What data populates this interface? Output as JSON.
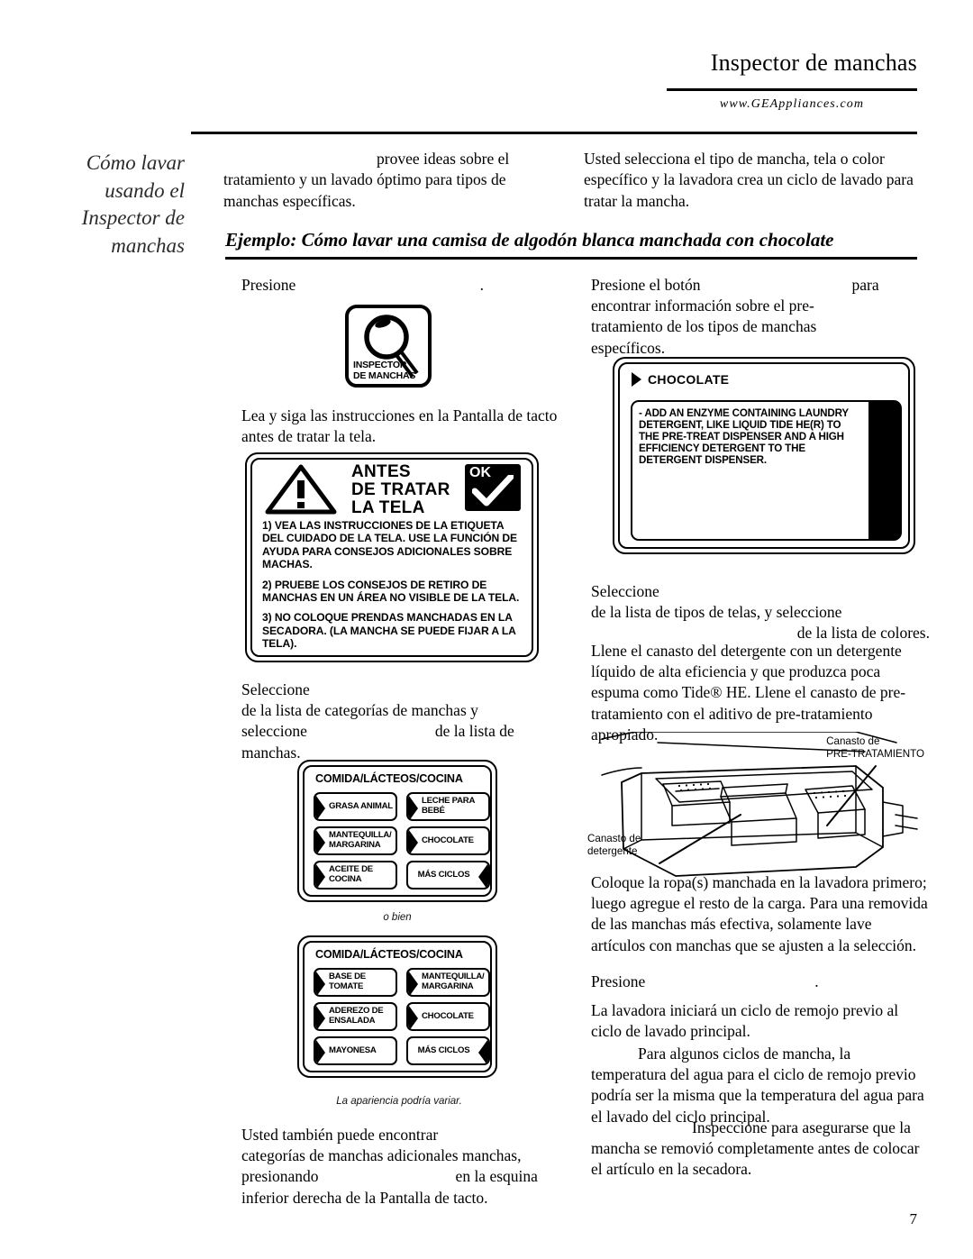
{
  "header": {
    "title": "Inspector de manchas",
    "url": "www.GEAppliances.com"
  },
  "side_title": "Cómo lavar usando el Inspector de manchas",
  "intro": {
    "left": "provee ideas sobre el tratamiento y un lavado óptimo para tipos de manchas específicas.",
    "right": "Usted selecciona el tipo de mancha, tela o color específico y la lavadora crea un ciclo de lavado para tratar la mancha."
  },
  "example_heading": "Ejemplo: Cómo lavar una camisa de algodón blanca manchada con chocolate",
  "left_column": {
    "step1": "Presione",
    "step1_tail": ".",
    "inspector_button": {
      "line1": "INSPECTOR",
      "line2": "DE MANCHAS"
    },
    "step2": "Lea y siga las instrucciones en la Pantalla de tacto antes de tratar la tela.",
    "antes_box": {
      "title_line1": "ANTES",
      "title_line2": "DE TRATAR",
      "title_line3": "LA TELA",
      "ok_label": "OK",
      "items": [
        "1) VEA LAS INSTRUCCIONES DE LA ETIQUETA DEL CUIDADO DE LA TELA. USE LA FUNCIÓN DE AYUDA PARA CONSEJOS ADICIONALES SOBRE MACHAS.",
        "2) PRUEBE LOS CONSEJOS DE RETIRO DE MANCHAS EN UN ÁREA NO VISIBLE DE LA TELA.",
        "3) NO COLOQUE PRENDAS MANCHADAS EN LA SECADORA. (LA MANCHA SE PUEDE FIJAR A LA TELA)."
      ]
    },
    "step3_a": "Seleccione",
    "step3_b": "de la lista de categorías de manchas y",
    "step3_c": "seleccione",
    "step3_d": "de la lista de",
    "step3_e": "manchas.",
    "menu1": {
      "title": "COMIDA/LÁCTEOS/COCINA",
      "buttons": [
        {
          "label": "GRASA ANIMAL",
          "arrow": "left"
        },
        {
          "label": "LECHE PARA BEBÉ",
          "arrow": "left"
        },
        {
          "label": "MANTEQUILLA/ MARGARINA",
          "arrow": "left"
        },
        {
          "label": "CHOCOLATE",
          "arrow": "left"
        },
        {
          "label": "ACEITE DE COCINA",
          "arrow": "left"
        },
        {
          "label": "MÁS CICLOS",
          "arrow": "right"
        }
      ]
    },
    "or_caption": "o bien",
    "menu2": {
      "title": "COMIDA/LÁCTEOS/COCINA",
      "buttons": [
        {
          "label": "BASE DE TOMATE",
          "arrow": "left"
        },
        {
          "label": "MANTEQUILLA/ MARGARINA",
          "arrow": "left"
        },
        {
          "label": "ADEREZO DE ENSALADA",
          "arrow": "left"
        },
        {
          "label": "CHOCOLATE",
          "arrow": "left"
        },
        {
          "label": "MAYONESA",
          "arrow": "left"
        },
        {
          "label": "MÁS CICLOS",
          "arrow": "right"
        }
      ]
    },
    "variation_caption": "La apariencia podría variar.",
    "step4_a": "Usted también puede encontrar",
    "step4_b": "categorías de manchas adicionales manchas,",
    "step4_c": "presionando",
    "step4_d": "en la esquina",
    "step4_e": "inferior derecha de la Pantalla de tacto."
  },
  "right_column": {
    "step1_a": "Presione el botón",
    "step1_b": "para",
    "step1_c": "encontrar información sobre el pre-",
    "step1_d": "tratamiento de los tipos de manchas",
    "step1_e": "específicos.",
    "chocolate_panel": {
      "heading": "CHOCOLATE",
      "body": "- ADD AN ENZYME CONTAINING LAUNDRY DETERGENT, LIKE LIQUID TIDE HE(R) TO THE PRE-TREAT DISPENSER AND A HIGH EFFICIENCY DETERGENT TO THE DETERGENT DISPENSER."
    },
    "step2_a": "Seleccione",
    "step2_b": "de la lista de tipos de telas, y seleccione",
    "step2_c": "de la lista de colores.",
    "step3": "Llene el canasto del detergente con un detergente líquido de alta eficiencia y que produzca poca espuma como Tide® HE. Llene el canasto de pre-tratamiento con el aditivo de pre-tratamiento apropiado.",
    "dispenser": {
      "label_pre_line1": "Canasto de",
      "label_pre_line2": "PRE-TRATAMIENTO",
      "label_det_line1": "Canasto de",
      "label_det_line2": "detergente"
    },
    "step4": "Coloque la ropa(s) manchada en la lavadora primero; luego agregue el resto de la carga. Para una removida de las manchas más efectiva, solamente lave artículos con manchas que se ajusten a la selección.",
    "step5_a": "Presione",
    "step5_b": ".",
    "step6": "La lavadora iniciará un ciclo de remojo previo al ciclo de lavado principal.",
    "step7": "Para algunos ciclos de mancha, la temperatura del agua para el ciclo de remojo previo podría ser la misma que la temperatura del agua para el lavado del ciclo principal.",
    "step8": "Inspeccione para asegurarse que la mancha se removió completamente antes de colocar el artículo en la secadora."
  },
  "page_number": "7"
}
